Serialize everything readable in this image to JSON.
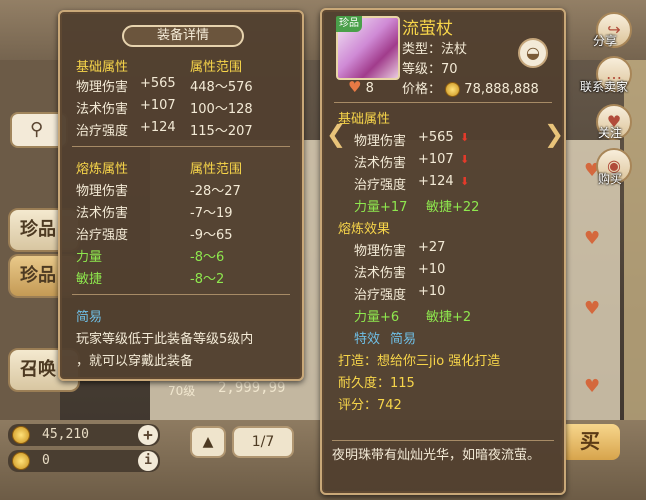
{
  "background": {
    "tabs": [
      "珍品",
      "珍品",
      "召唤"
    ],
    "gold_amount": "45,210",
    "silver_amount": "0",
    "page_indicator": "1/7",
    "bg_level": "70级",
    "bg_price": "2,999,99",
    "buy_label": "买"
  },
  "left_panel": {
    "title": "装备详情",
    "base_header": "基础属性",
    "range_header": "属性范围",
    "base_stats": [
      {
        "name": "物理伤害",
        "value": "+565",
        "range": "448～576"
      },
      {
        "name": "法术伤害",
        "value": "+107",
        "range": "100～128"
      },
      {
        "name": "治疗强度",
        "value": "+124",
        "range": "115～207"
      }
    ],
    "refine_header": "熔炼属性",
    "refine_range_header": "属性范围",
    "refine_stats": [
      {
        "name": "物理伤害",
        "range": "-28～27"
      },
      {
        "name": "法术伤害",
        "range": "-7～19"
      },
      {
        "name": "治疗强度",
        "range": "-9～65"
      },
      {
        "name": "力量",
        "range": "-8～6"
      },
      {
        "name": "敏捷",
        "range": "-8～2"
      }
    ],
    "easy_label": "简易",
    "easy_desc_1": "玩家等级低于此装备等级5级内",
    "easy_desc_2": "，就可以穿戴此装备"
  },
  "right_panel": {
    "rare_badge": "珍品",
    "item_name": "流萤杖",
    "type_text": "类型：法杖",
    "level_text": "等级：70",
    "favorites": "8",
    "price_label": "价格：",
    "price_value": "78,888,888",
    "base_header": "基础属性",
    "base_stats": [
      {
        "name": "物理伤害",
        "value": "+565"
      },
      {
        "name": "法术伤害",
        "value": "+107"
      },
      {
        "name": "治疗强度",
        "value": "+124"
      }
    ],
    "bonus_str": "力量+17",
    "bonus_agi": "敏捷+22",
    "refine_header": "熔炼效果",
    "refine_stats": [
      {
        "name": "物理伤害",
        "value": "+27"
      },
      {
        "name": "法术伤害",
        "value": "+10"
      },
      {
        "name": "治疗强度",
        "value": "+10"
      }
    ],
    "refine_str": "力量+6",
    "refine_agi": "敏捷+2",
    "special_label": "特效",
    "special_value": "简易",
    "forge_text": "打造：想给你三jio  强化打造",
    "durability_text": "耐久度：115",
    "score_text": "评分：742",
    "description": "夜明珠带有灿灿光华，如暗夜流萤。"
  },
  "side_actions": {
    "share": "分享",
    "contact": "联系卖家",
    "follow": "关注",
    "buy": "购买"
  }
}
